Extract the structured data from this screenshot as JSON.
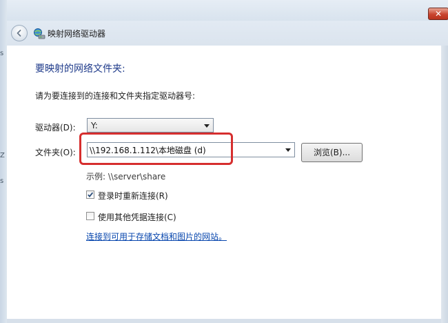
{
  "window": {
    "title": "映射网络驱动器",
    "close_glyph": "✕"
  },
  "left_strip": {
    "glyph_a": "s",
    "glyph_b": "Z",
    "glyph_c": "s"
  },
  "page": {
    "heading": "要映射的网络文件夹:",
    "instruction": "请为要连接到的连接和文件夹指定驱动器号:",
    "drive": {
      "label": "驱动器(D):",
      "value": "Y:"
    },
    "folder": {
      "label": "文件夹(O):",
      "value": "\\\\192.168.1.112\\本地磁盘 (d)"
    },
    "browse_label": "浏览(B)...",
    "example": "示例: \\\\server\\share",
    "options": [
      {
        "label": "登录时重新连接(R)",
        "checked": true
      },
      {
        "label": "使用其他凭据连接(C)",
        "checked": false
      }
    ],
    "link_text": "连接到可用于存储文档和图片的网站。"
  },
  "colors": {
    "highlight": "#d62e2e",
    "heading": "#1e3a8a",
    "link": "#0645ad"
  },
  "icons": [
    "back-arrow-icon",
    "network-drive-icon",
    "close-icon",
    "chevron-down-icon",
    "checkmark-icon"
  ]
}
